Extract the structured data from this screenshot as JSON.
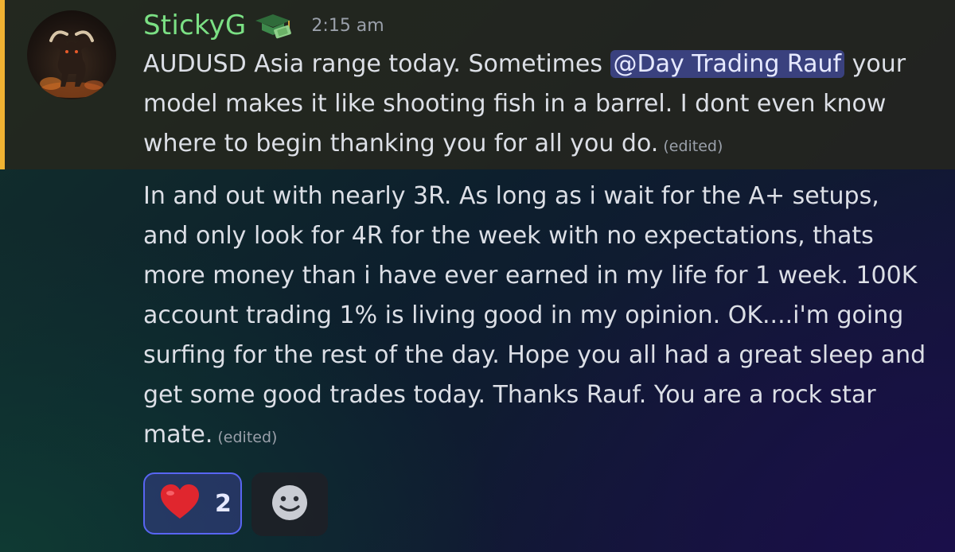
{
  "message": {
    "author": "StickyG",
    "role_icon": "graduation-cap-money-icon",
    "timestamp": "2:15 am",
    "part1_before_mention": "AUDUSD Asia range today. Sometimes ",
    "mention": "@Day Trading Rauf",
    "part1_after_mention": " your model makes it like shooting fish in a barrel. I dont even know where to begin thanking you for all you do.",
    "edited_label": "(edited)"
  },
  "followup": {
    "text": "In and out with nearly 3R. As long as i wait for the A+ setups, and only look for 4R for the week with no expectations, thats more money than i have ever earned in my life for 1 week. 100K account trading 1% is living good in my opinion. OK....i'm going surfing for the rest of the day. Hope you all had a great sleep and get some good trades today. Thanks Rauf. You are a rock star mate.",
    "edited_label": "(edited)"
  },
  "reactions": [
    {
      "emoji": "heart-icon",
      "count": "2",
      "selected": true
    }
  ],
  "add_reaction_icon": "smiley-icon",
  "colors": {
    "username": "#7be084",
    "mention_bg": "#5865f2",
    "highlight_bar": "#f0b232"
  }
}
